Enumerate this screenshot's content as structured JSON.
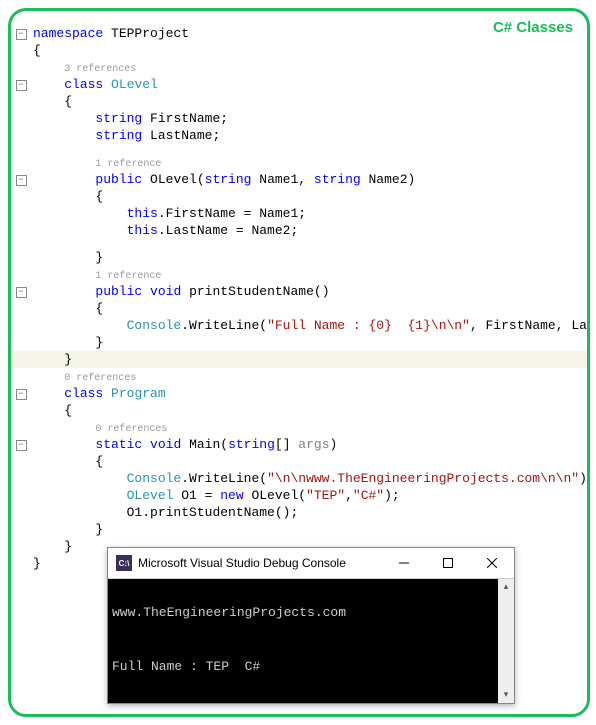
{
  "badge": "C# Classes",
  "code": {
    "namespace_kw": "namespace",
    "namespace_name": " TEPProject",
    "lbrace": "{",
    "rbrace": "}",
    "ref3": "3 references",
    "ref1": "1 reference",
    "ref0": "0 references",
    "class_kw": "class",
    "olevel": " OLevel",
    "program": " Program",
    "string_kw": "string",
    "firstname_decl": " FirstName;",
    "lastname_decl": " LastName;",
    "public_kw": "public",
    "void_kw": "void",
    "static_kw": "static",
    "olevel_ctor": " OLevel(",
    "name1": " Name1, ",
    "name2": " Name2)",
    "this_fn": "this",
    "assign_fn": ".FirstName = Name1;",
    "assign_ln": ".LastName = Name2;",
    "print_method": " printStudentName()",
    "console_type": "Console",
    "writeline": ".WriteLine(",
    "fullname_str": "\"Full Name : {0}  {1}\\n\\n\"",
    "fullname_args": ", FirstName, LastName);",
    "main": " Main(",
    "string_arr": "[] ",
    "args": "args",
    "paren_close": ")",
    "url_str": "\"\\n\\nwww.TheEngineeringProjects.com\\n\\n\"",
    "close_stmt": ");",
    "olevel_type": "OLevel",
    "o1_decl": " O1 = ",
    "new_kw": "new",
    "ctor_call": " OLevel(",
    "tep_str": "\"TEP\"",
    "comma": ",",
    "cs_str": "\"C#\"",
    "o1_print": "O1.printStudentName();"
  },
  "console": {
    "title": "Microsoft Visual Studio Debug Console",
    "icon_text": "C:\\",
    "line1": "www.TheEngineeringProjects.com",
    "line2": "Full Name : TEP  C#"
  }
}
